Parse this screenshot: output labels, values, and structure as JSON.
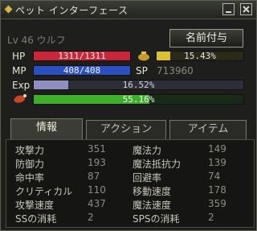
{
  "window": {
    "title": "ペット インターフェース"
  },
  "level_text": "Lv  46 ウルフ",
  "name_button": "名前付与",
  "hp": {
    "label": "HP",
    "value": "1311/1311",
    "fraction": 1.0
  },
  "mp": {
    "label": "MP",
    "value": "408/408",
    "fraction": 1.0
  },
  "exp": {
    "label": "Exp",
    "value": "16.52%",
    "fraction": 0.1652
  },
  "satiety": {
    "value": "55.16%",
    "fraction": 0.5516
  },
  "weight": {
    "value": "15.43%",
    "fraction": 0.1543
  },
  "sp": {
    "label": "SP",
    "value": "713960"
  },
  "tabs": [
    {
      "label": "情報",
      "active": true
    },
    {
      "label": "アクション",
      "active": false
    },
    {
      "label": "アイテム",
      "active": false
    }
  ],
  "stats_left": [
    {
      "label": "攻撃力",
      "value": "351"
    },
    {
      "label": "防御力",
      "value": "193"
    },
    {
      "label": "命中率",
      "value": "87"
    },
    {
      "label": "クリティカル",
      "value": "110"
    },
    {
      "label": "攻撃速度",
      "value": "437"
    },
    {
      "label": "SSの消耗",
      "value": "2"
    }
  ],
  "stats_right": [
    {
      "label": "魔法力",
      "value": "149"
    },
    {
      "label": "魔法抵抗力",
      "value": "139"
    },
    {
      "label": "回避率",
      "value": "74"
    },
    {
      "label": "移動速度",
      "value": "178"
    },
    {
      "label": "魔法速度",
      "value": "359"
    },
    {
      "label": "SPSの消耗",
      "value": "2"
    }
  ],
  "colors": {
    "hp": "#c8263a",
    "mp": "#2c4fbf",
    "exp": "#8f8fbf",
    "satiety": "#3fae2a",
    "weight": "#d8c234"
  }
}
